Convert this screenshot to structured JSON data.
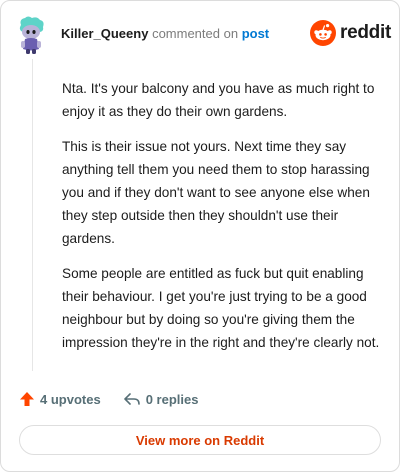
{
  "header": {
    "username": "Killer_Queeny",
    "commented_text": "commented on",
    "post_link": "post",
    "brand": "reddit",
    "avatar_icon": "snoo-avatar-icon",
    "brand_icon": "reddit-logo-icon"
  },
  "comment": {
    "paragraphs": [
      "Nta. It's your balcony and you have as much right to enjoy it as they do their own gardens.",
      "This is their issue not yours. Next time they say anything tell them you need them to stop harassing you and if they don't want to see anyone else when they step outside then they shouldn't use their gardens.",
      "Some people are entitled as fuck but quit enabling their behaviour. I get you're just trying to be a good neighbour but by doing so you're giving them the impression they're in the right and they're clearly not."
    ]
  },
  "actions": {
    "upvotes_label": "4 upvotes",
    "replies_label": "0 replies",
    "upvote_icon": "upvote-arrow-icon",
    "reply_icon": "reply-arrow-icon"
  },
  "footer": {
    "view_more_label": "View more on Reddit"
  },
  "colors": {
    "brand_orange": "#ff4500",
    "link_blue": "#0079d3",
    "view_more_text": "#d93a00",
    "muted_text": "#576f76",
    "avatar_teal": "#5ed3c8",
    "avatar_purple": "#6a5fb0"
  }
}
